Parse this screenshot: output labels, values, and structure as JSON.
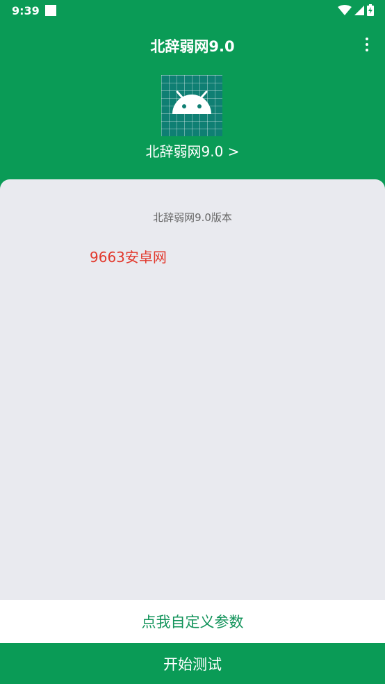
{
  "status_bar": {
    "time": "9:39",
    "icons": [
      "notification-square-icon",
      "wifi-icon",
      "signal-icon",
      "battery-charging-icon"
    ]
  },
  "header": {
    "title": "北辞弱网9.0",
    "menu_icon": "more-vert-icon"
  },
  "hero": {
    "icon": "android-app-icon",
    "version_link": "北辞弱网9.0 >"
  },
  "content": {
    "version_caption": "北辞弱网9.0版本",
    "watermark": "9663安卓网"
  },
  "actions": {
    "custom_params": "点我自定义参数",
    "start_test": "开始测试"
  },
  "colors": {
    "brand_green": "#0a9b56",
    "panel_bg": "#e9eaef",
    "watermark_red": "#e2372b"
  }
}
